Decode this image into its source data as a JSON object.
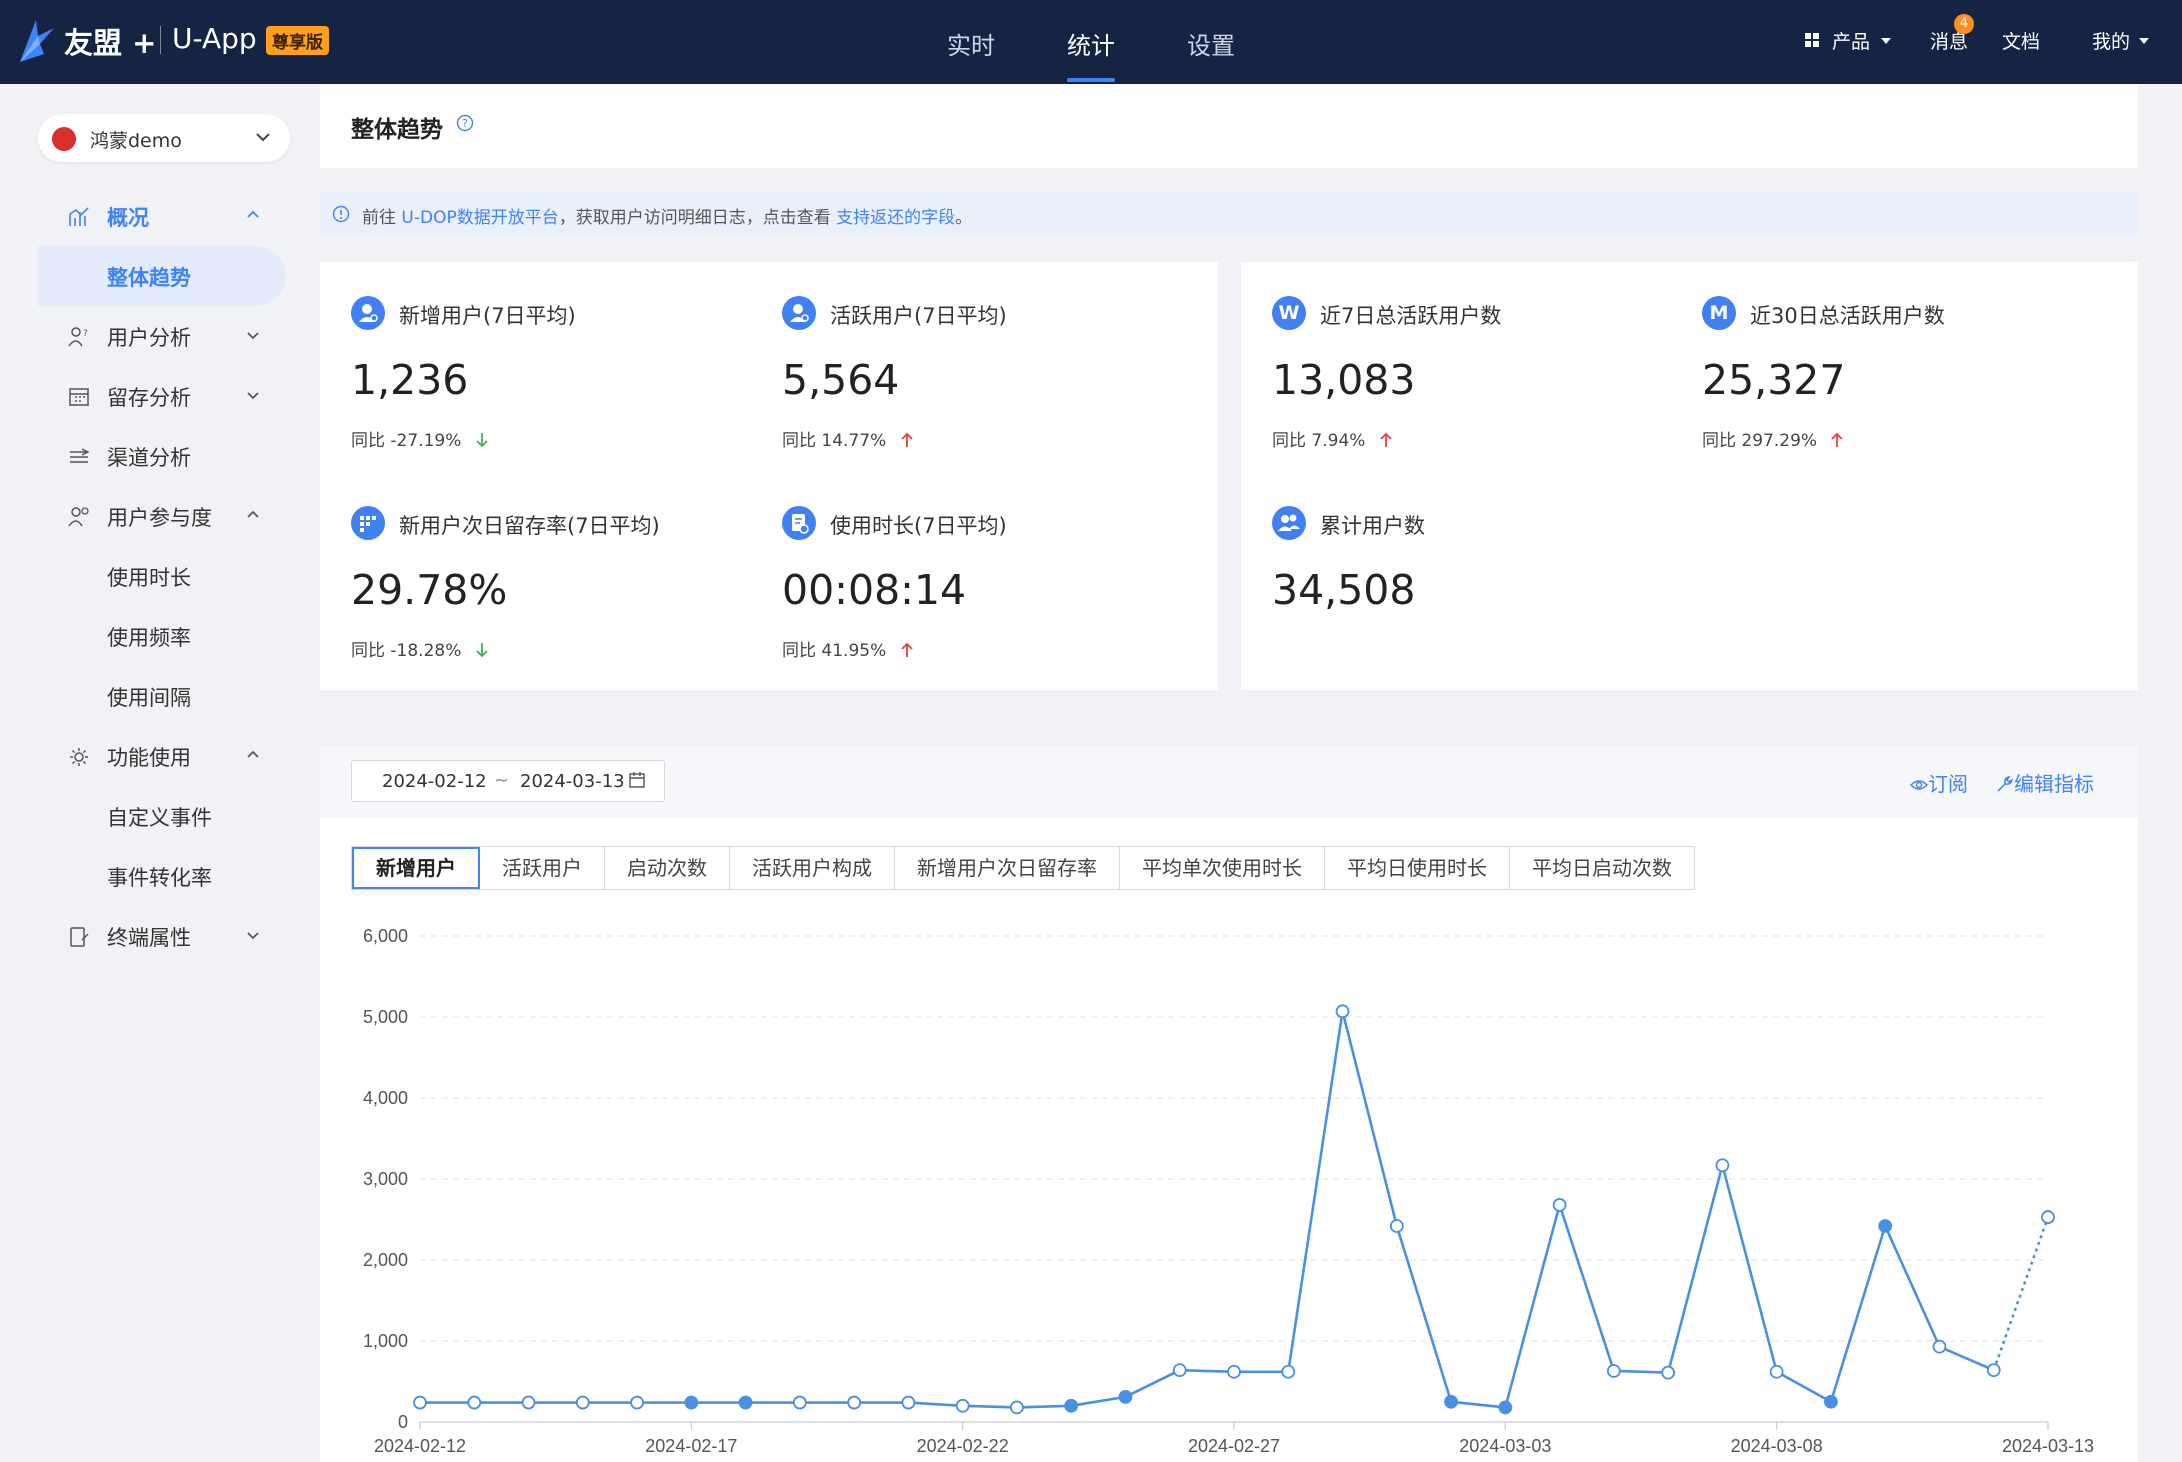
{
  "header": {
    "brand": "友盟 +",
    "app": "U-App",
    "edition_badge": "尊享版",
    "nav": [
      "实时",
      "统计",
      "设置"
    ],
    "active_nav": "统计",
    "right": {
      "products": "产品",
      "messages": "消息",
      "messages_badge": "4",
      "docs": "文档",
      "mine": "我的"
    },
    "colors": {
      "bg": "#162443",
      "accent": "#3e83f8",
      "badge": "#ff8f1f"
    }
  },
  "sidebar": {
    "app_select": "鸿蒙demo",
    "menu": [
      {
        "label": "概况",
        "icon": "overview-chart-icon",
        "expanded": true,
        "active": true,
        "children": [
          {
            "label": "整体趋势",
            "active": true
          }
        ]
      },
      {
        "label": "用户分析",
        "icon": "user-analysis-icon",
        "expanded": false,
        "children": []
      },
      {
        "label": "留存分析",
        "icon": "retention-grid-icon",
        "expanded": false,
        "children": []
      },
      {
        "label": "渠道分析",
        "icon": "channel-flow-icon",
        "expanded": false,
        "children": []
      },
      {
        "label": "用户参与度",
        "icon": "engagement-icon",
        "expanded": true,
        "children": [
          {
            "label": "使用时长"
          },
          {
            "label": "使用频率"
          },
          {
            "label": "使用间隔"
          }
        ]
      },
      {
        "label": "功能使用",
        "icon": "gear-icon",
        "expanded": true,
        "children": [
          {
            "label": "自定义事件"
          },
          {
            "label": "事件转化率"
          }
        ]
      },
      {
        "label": "终端属性",
        "icon": "device-icon",
        "expanded": false,
        "children": []
      }
    ]
  },
  "page": {
    "title": "整体趋势",
    "notice": {
      "prefix": "前往",
      "link1": "U-DOP数据开放平台",
      "middle": "，获取用户访问明细日志，点击查看",
      "link2": "支持返还的字段",
      "suffix": "。"
    }
  },
  "stats_left": [
    {
      "label": "新增用户(7日平均)",
      "value": "1,236",
      "yoy_label": "同比",
      "yoy": "-27.19%",
      "trend": "down",
      "icon": "new-user-icon"
    },
    {
      "label": "活跃用户(7日平均)",
      "value": "5,564",
      "yoy_label": "同比",
      "yoy": "14.77%",
      "trend": "up",
      "icon": "active-user-icon"
    },
    {
      "label": "新用户次日留存率(7日平均)",
      "value": "29.78%",
      "yoy_label": "同比",
      "yoy": "-18.28%",
      "trend": "down",
      "icon": "retention-icon"
    },
    {
      "label": "使用时长(7日平均)",
      "value": "00:08:14",
      "yoy_label": "同比",
      "yoy": "41.95%",
      "trend": "up",
      "icon": "duration-icon"
    }
  ],
  "stats_right": [
    {
      "label": "近7日总活跃用户数",
      "value": "13,083",
      "yoy_label": "同比",
      "yoy": "7.94%",
      "trend": "up",
      "icon_letter": "W"
    },
    {
      "label": "近30日总活跃用户数",
      "value": "25,327",
      "yoy_label": "同比",
      "yoy": "297.29%",
      "trend": "up",
      "icon_letter": "M"
    },
    {
      "label": "累计用户数",
      "value": "34,508",
      "icon": "users-group-icon"
    }
  ],
  "trend": {
    "date_start": "2024-02-12",
    "date_sep": "~",
    "date_end": "2024-03-13",
    "subscribe": "订阅",
    "edit_metrics": "编辑指标",
    "tabs": [
      "新增用户",
      "活跃用户",
      "启动次数",
      "活跃用户构成",
      "新增用户次日留存率",
      "平均单次使用时长",
      "平均日使用时长",
      "平均日启动次数"
    ],
    "active_tab": "新增用户"
  },
  "chart_data": {
    "type": "line",
    "x": [
      "2024-02-12",
      "2024-02-13",
      "2024-02-14",
      "2024-02-15",
      "2024-02-16",
      "2024-02-17",
      "2024-02-18",
      "2024-02-19",
      "2024-02-20",
      "2024-02-21",
      "2024-02-22",
      "2024-02-23",
      "2024-02-24",
      "2024-02-25",
      "2024-02-26",
      "2024-02-27",
      "2024-02-28",
      "2024-02-29",
      "2024-03-01",
      "2024-03-02",
      "2024-03-03",
      "2024-03-04",
      "2024-03-05",
      "2024-03-06",
      "2024-03-07",
      "2024-03-08",
      "2024-03-09",
      "2024-03-10",
      "2024-03-11",
      "2024-03-12",
      "2024-03-13"
    ],
    "x_tick_labels": [
      "2024-02-12",
      "2024-02-17",
      "2024-02-22",
      "2024-02-27",
      "2024-03-03",
      "2024-03-08",
      "2024-03-13"
    ],
    "series": [
      {
        "values": [
          240,
          240,
          240,
          240,
          240,
          240,
          240,
          240,
          240,
          240,
          200,
          180,
          200,
          310,
          640,
          620,
          620,
          5070,
          2420,
          250,
          180,
          2680,
          630,
          610,
          3170,
          620,
          250,
          2420,
          930,
          640,
          2530
        ],
        "filled_points": [
          5,
          6,
          12,
          13,
          19,
          20,
          26,
          27
        ],
        "last_segment_dashed": true
      }
    ],
    "ylim": [
      0,
      6000
    ],
    "yticks": [
      0,
      1000,
      2000,
      3000,
      4000,
      5000,
      6000
    ],
    "ytick_labels": [
      "0",
      "1,000",
      "2,000",
      "3,000",
      "4,000",
      "5,000",
      "6,000"
    ],
    "grid": true,
    "color": "#4a90e2"
  }
}
